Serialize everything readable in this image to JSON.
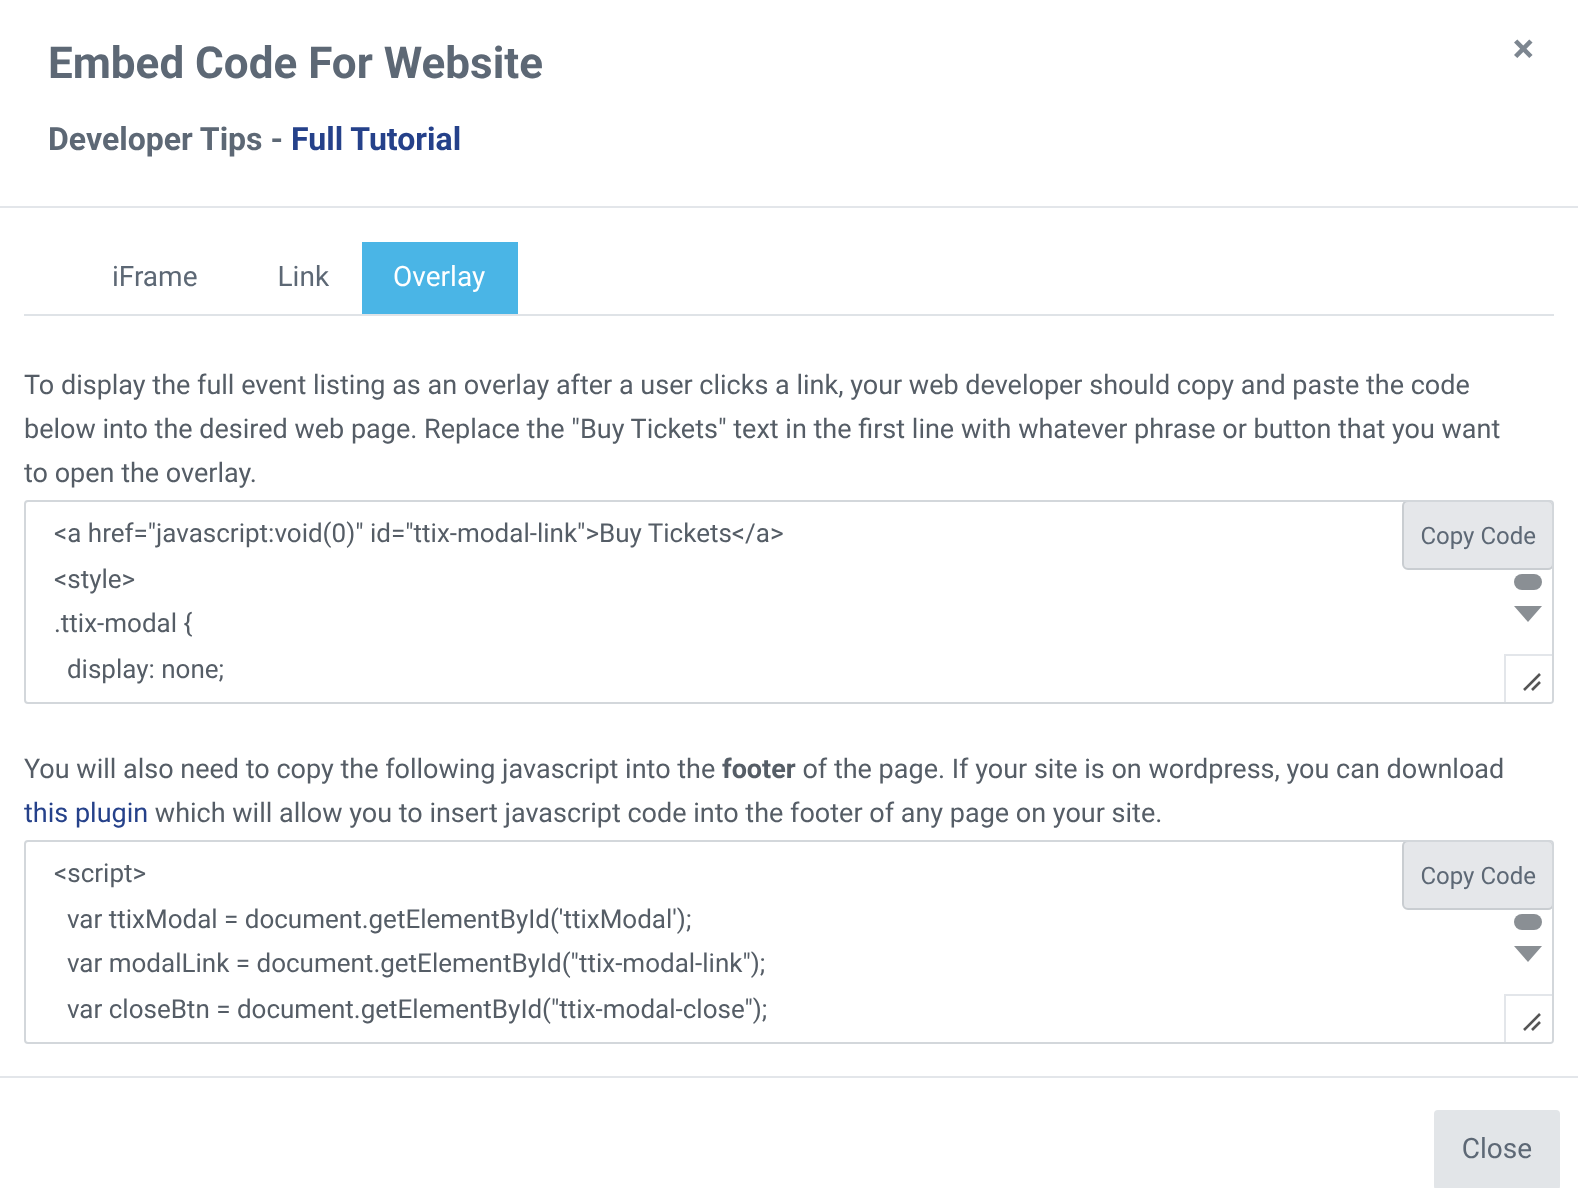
{
  "dialog": {
    "title": "Embed Code For Website",
    "subtitle_prefix": "Developer Tips - ",
    "subtitle_link": "Full Tutorial",
    "close_icon": "×"
  },
  "tabs": [
    {
      "label": "iFrame",
      "selected": false
    },
    {
      "label": "Link",
      "selected": false
    },
    {
      "label": "Overlay",
      "selected": true
    }
  ],
  "sections": [
    {
      "description": [
        {
          "kind": "text",
          "text": "To display the full event listing as an overlay after a user clicks a link, your web developer should copy and paste the code below into the desired web page. Replace the \"Buy Tickets\" text in the first line with whatever phrase or button that you want to open the overlay."
        }
      ],
      "code_lines": [
        "<a href=\"javascript:void(0)\" id=\"ttix-modal-link\">Buy Tickets</a>",
        "<style>",
        ".ttix-modal {",
        "  display: none;"
      ],
      "copy_button": "Copy Code"
    },
    {
      "description": [
        {
          "kind": "text",
          "text": "You will also need to copy the following javascript into the **footer** of the page. If your site is on wordpress, you can download "
        },
        {
          "kind": "link",
          "text": "this plugin"
        },
        {
          "kind": "text",
          "text": " which will allow you to insert javascript code into the footer of any page on your site."
        }
      ],
      "code_lines": [
        "<script>",
        "  var ttixModal = document.getElementById('ttixModal');",
        "  var modalLink = document.getElementById(\"ttix-modal-link\");",
        "  var closeBtn = document.getElementById(\"ttix-modal-close\");"
      ],
      "copy_button": "Copy Code"
    }
  ],
  "footer": {
    "close_button": "Close"
  }
}
